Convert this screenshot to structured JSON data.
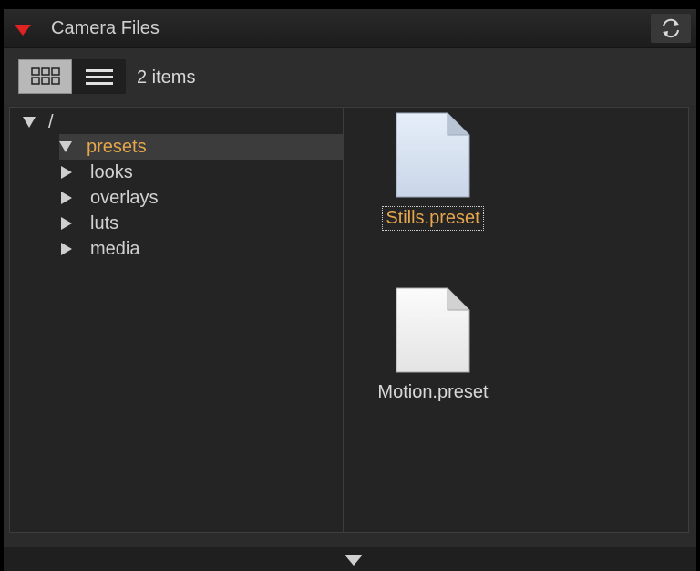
{
  "panel": {
    "title": "Camera Files",
    "collapse_icon": "caret-down-icon",
    "refresh_icon": "refresh-icon",
    "accent_color": "#e02222"
  },
  "toolbar": {
    "grid_view_icon": "grid-view-icon",
    "list_view_icon": "list-view-icon",
    "items_count": "2 items"
  },
  "tree": {
    "root": "/",
    "items": [
      {
        "label": "presets",
        "expanded": true,
        "selected": true
      },
      {
        "label": "looks",
        "expanded": false,
        "selected": false
      },
      {
        "label": "overlays",
        "expanded": false,
        "selected": false
      },
      {
        "label": "luts",
        "expanded": false,
        "selected": false
      },
      {
        "label": "media",
        "expanded": false,
        "selected": false
      }
    ]
  },
  "files": [
    {
      "name": "Stills.preset",
      "icon": "document-icon",
      "selected": true
    },
    {
      "name": "Motion.preset",
      "icon": "document-icon",
      "selected": false
    }
  ],
  "footer": {
    "expand_icon": "caret-down-icon"
  },
  "colors": {
    "selection_text": "#e5a64c",
    "background": "#242424"
  }
}
